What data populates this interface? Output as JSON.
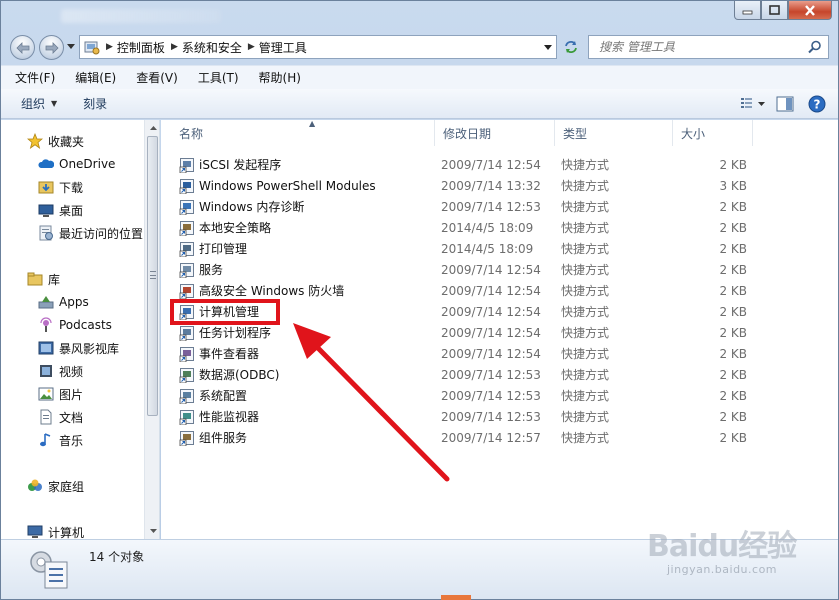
{
  "address": {
    "crumbs": [
      "控制面板",
      "系统和安全",
      "管理工具"
    ],
    "search_placeholder": "搜索 管理工具"
  },
  "menu": [
    "文件(F)",
    "编辑(E)",
    "查看(V)",
    "工具(T)",
    "帮助(H)"
  ],
  "toolbar": {
    "organize": "组织",
    "burn": "刻录"
  },
  "nav": {
    "favorites": "收藏夹",
    "onedrive": "OneDrive",
    "downloads": "下载",
    "desktop": "桌面",
    "recent": "最近访问的位置",
    "libraries": "库",
    "apps": "Apps",
    "podcasts": "Podcasts",
    "baofeng": "暴风影视库",
    "videos": "视频",
    "pictures": "图片",
    "documents": "文档",
    "music": "音乐",
    "homegroup": "家庭组",
    "computer": "计算机"
  },
  "columns": {
    "name": "名称",
    "date": "修改日期",
    "type": "类型",
    "size": "大小"
  },
  "files": [
    {
      "name": "iSCSI 发起程序",
      "date": "2009/7/14 12:54",
      "type": "快捷方式",
      "size": "2 KB"
    },
    {
      "name": "Windows PowerShell Modules",
      "date": "2009/7/14 13:32",
      "type": "快捷方式",
      "size": "3 KB"
    },
    {
      "name": "Windows 内存诊断",
      "date": "2009/7/14 12:53",
      "type": "快捷方式",
      "size": "2 KB"
    },
    {
      "name": "本地安全策略",
      "date": "2014/4/5 18:09",
      "type": "快捷方式",
      "size": "2 KB"
    },
    {
      "name": "打印管理",
      "date": "2014/4/5 18:09",
      "type": "快捷方式",
      "size": "2 KB"
    },
    {
      "name": "服务",
      "date": "2009/7/14 12:54",
      "type": "快捷方式",
      "size": "2 KB"
    },
    {
      "name": "高级安全 Windows 防火墙",
      "date": "2009/7/14 12:54",
      "type": "快捷方式",
      "size": "2 KB"
    },
    {
      "name": "计算机管理",
      "date": "2009/7/14 12:54",
      "type": "快捷方式",
      "size": "2 KB"
    },
    {
      "name": "任务计划程序",
      "date": "2009/7/14 12:54",
      "type": "快捷方式",
      "size": "2 KB"
    },
    {
      "name": "事件查看器",
      "date": "2009/7/14 12:54",
      "type": "快捷方式",
      "size": "2 KB"
    },
    {
      "name": "数据源(ODBC)",
      "date": "2009/7/14 12:53",
      "type": "快捷方式",
      "size": "2 KB"
    },
    {
      "name": "系统配置",
      "date": "2009/7/14 12:53",
      "type": "快捷方式",
      "size": "2 KB"
    },
    {
      "name": "性能监视器",
      "date": "2009/7/14 12:53",
      "type": "快捷方式",
      "size": "2 KB"
    },
    {
      "name": "组件服务",
      "date": "2009/7/14 12:57",
      "type": "快捷方式",
      "size": "2 KB"
    }
  ],
  "status": {
    "count": "14 个对象"
  },
  "watermark": {
    "logo": "Baidu经验",
    "url": "jingyan.baidu.com"
  },
  "colors": {
    "highlight": "#e0141b",
    "accent": "#1e395b"
  }
}
